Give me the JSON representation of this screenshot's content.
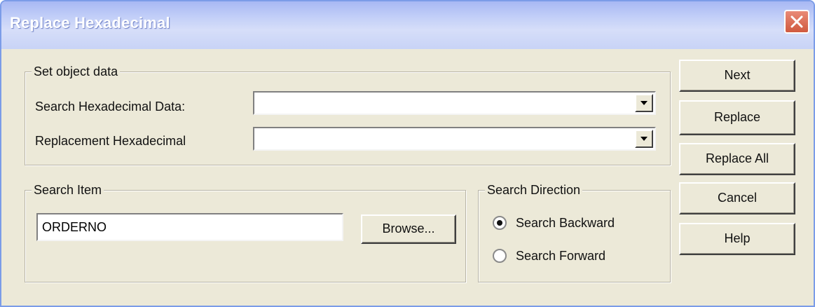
{
  "window": {
    "title": "Replace Hexadecimal"
  },
  "object_data": {
    "legend": "Set object data",
    "search_label": "Search Hexadecimal Data:",
    "search_value": "",
    "replacement_label": "Replacement Hexadecimal",
    "replacement_value": ""
  },
  "search_item": {
    "legend": "Search Item",
    "value": "ORDERNO",
    "browse_label": "Browse..."
  },
  "search_direction": {
    "legend": "Search Direction",
    "backward_label": "Search Backward",
    "forward_label": "Search Forward",
    "selected": "Search Backward"
  },
  "buttons": {
    "next": "Next",
    "replace": "Replace",
    "replace_all": "Replace All",
    "cancel": "Cancel",
    "help": "Help"
  },
  "icons": {
    "close": "close-icon",
    "dropdown": "chevron-down-icon"
  },
  "colors": {
    "title_bar": "#c4d0f8",
    "dialog_background": "#ece9d8",
    "close_button": "#d05a3f"
  }
}
